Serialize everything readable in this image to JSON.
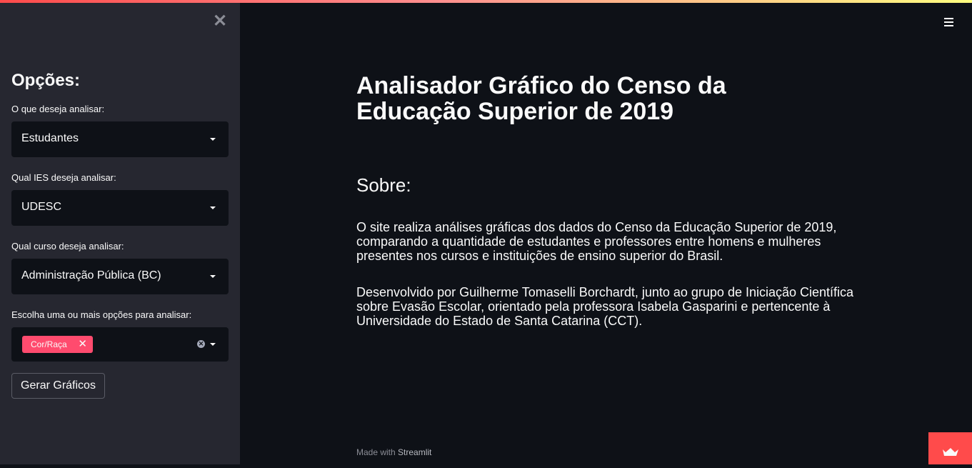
{
  "sidebar": {
    "close_icon": "✕",
    "title": "Opções:",
    "fields": [
      {
        "label": "O que deseja analisar:",
        "value": "Estudantes"
      },
      {
        "label": "Qual IES deseja analisar:",
        "value": "UDESC"
      },
      {
        "label": "Qual curso deseja analisar:",
        "value": "Administração Pública (BC)"
      }
    ],
    "multiselect": {
      "label": "Escolha uma ou mais opções para analisar:",
      "tags": [
        "Cor/Raça"
      ]
    },
    "generate_button": "Gerar Gráficos"
  },
  "main": {
    "title": "Analisador Gráfico do Censo da Educação Superior de 2019",
    "section_heading": "Sobre:",
    "paragraphs": [
      "O site realiza análises gráficas dos dados do Censo da Educação Superior de 2019, comparando a quantidade de estudantes e professores entre homens e mulheres presentes nos cursos e instituições de ensino superior do Brasil.",
      "Desenvolvido por Guilherme Tomaselli Borchardt, junto ao grupo de Iniciação Científica sobre Evasão Escolar, orientado pela professora Isabela Gasparini e pertencente à Universidade do Estado de Santa Catarina (CCT)."
    ]
  },
  "footer": {
    "made_with": "Made with",
    "brand": "Streamlit"
  },
  "colors": {
    "accent": "#ff4b4b",
    "tag": "#ff4b6e",
    "sidebar_bg": "#262730",
    "main_bg": "#0e1117"
  },
  "icons": [
    "close-icon",
    "hamburger-menu-icon",
    "caret-down-icon",
    "clear-all-icon",
    "crown-icon"
  ]
}
